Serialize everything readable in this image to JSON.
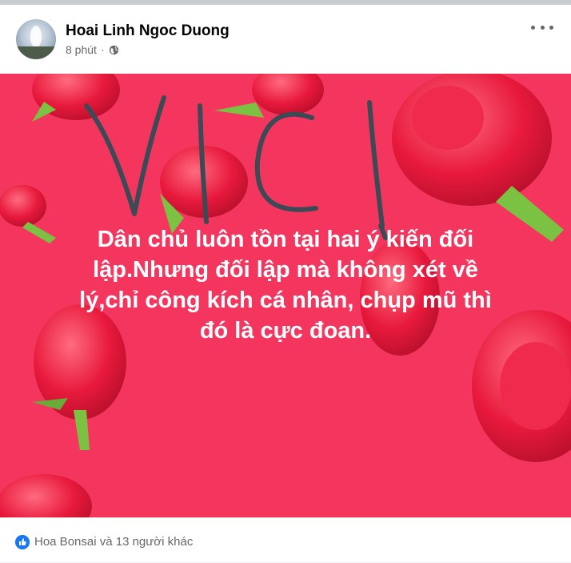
{
  "post": {
    "author": "Hoai Linh Ngoc Duong",
    "time": "8 phút",
    "separator": "·",
    "audience_icon": "globe-icon",
    "more_icon": "more-options-icon"
  },
  "image": {
    "handwritten": "VICI",
    "text_lines": [
      "Dân chủ luôn tồn tại hai ý kiến đối",
      "lập.Nhưng đối lập mà không xét về",
      "lý,chỉ công kích cá nhân, chụp mũ thì",
      "đó là cực đoan."
    ],
    "background_color": "#f4365f"
  },
  "footer": {
    "reaction_icon": "like-icon",
    "reactions": "Hoa Bonsai và 13 người khác"
  }
}
